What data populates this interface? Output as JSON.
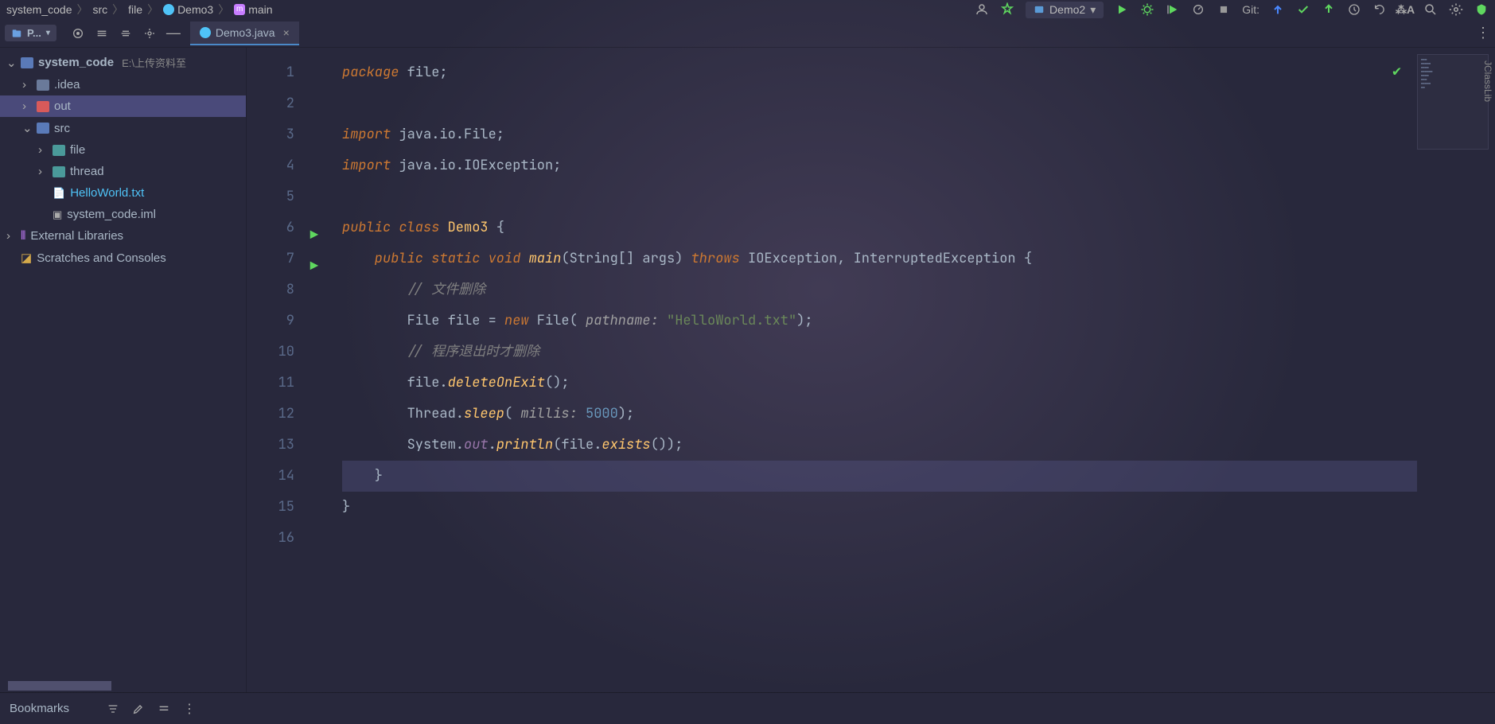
{
  "breadcrumb": {
    "root": "system_code",
    "p1": "src",
    "p2": "file",
    "p3": "Demo3",
    "p4": "main",
    "m": "m"
  },
  "runconfig": {
    "label": "Demo2"
  },
  "git": {
    "label": "Git:"
  },
  "proj_btn": "P...",
  "tab": {
    "file": "Demo3.java"
  },
  "more_icon": "⋮",
  "tree": {
    "root": {
      "name": "system_code",
      "path": "E:\\上传资料至"
    },
    "idea": ".idea",
    "out": "out",
    "src": "src",
    "file": "file",
    "thread": "thread",
    "hello": "HelloWorld.txt",
    "iml": "system_code.iml",
    "ext": "External Libraries",
    "scratch": "Scratches and Consoles"
  },
  "lines": [
    "1",
    "2",
    "3",
    "4",
    "5",
    "6",
    "7",
    "8",
    "9",
    "10",
    "11",
    "12",
    "13",
    "14",
    "15",
    "16"
  ],
  "code": {
    "l1a": "package",
    "l1b": " file;",
    "l3a": "import",
    "l3b": " java.io.File;",
    "l4a": "import",
    "l4b": " java.io.IOException;",
    "l6a": "public",
    "l6b": " class",
    "l6c": " Demo3",
    "l6d": " {",
    "l7a": "    public",
    "l7b": " static",
    "l7c": " void",
    "l7d": " main",
    "l7e": "(String[] args)",
    "l7f": " throws",
    "l7g": " IOException, InterruptedException ",
    "l7h": "{",
    "l8": "        // 文件删除",
    "l9a": "        File file = ",
    "l9b": "new",
    "l9c": " File",
    "l9d": "(",
    "l9e": " pathname:",
    "l9f": " \"HelloWorld.txt\"",
    "l9g": ");",
    "l10": "        // 程序退出时才删除",
    "l11a": "        file.",
    "l11b": "deleteOnExit",
    "l11c": "();",
    "l12a": "        Thread.",
    "l12b": "sleep",
    "l12c": "(",
    "l12d": " millis:",
    "l12e": " 5000",
    "l12f": ");",
    "l13a": "        System.",
    "l13b": "out",
    "l13c": ".",
    "l13d": "println",
    "l13e": "(file.",
    "l13f": "exists",
    "l13g": "());",
    "l14": "    }",
    "l15": "}"
  },
  "bottom": {
    "bookmarks": "Bookmarks"
  },
  "vtab": "JClassLib"
}
